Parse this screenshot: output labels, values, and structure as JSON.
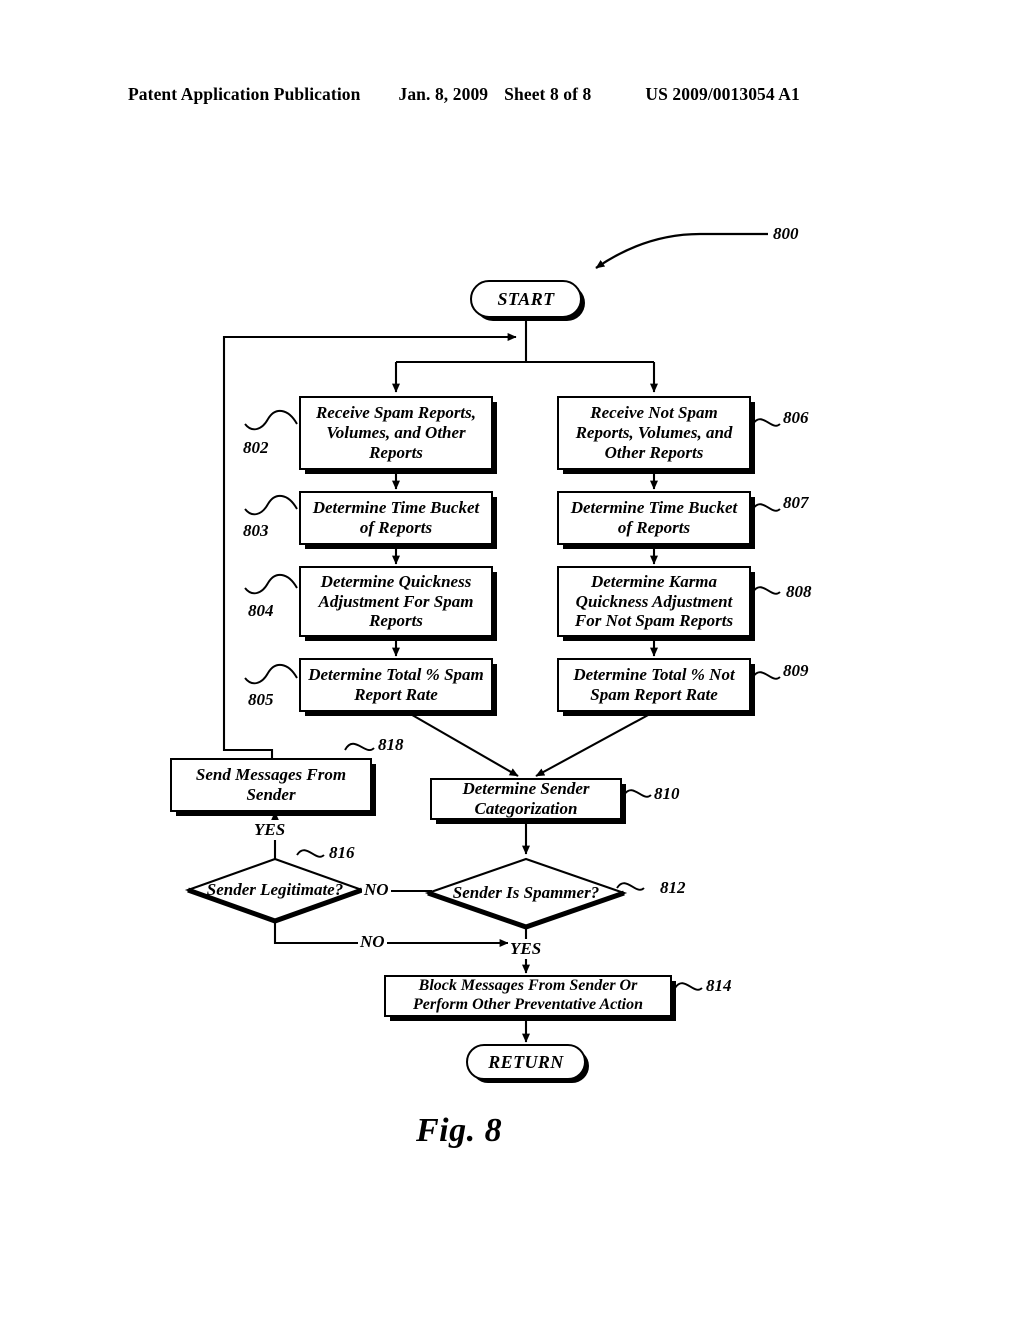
{
  "header": {
    "publication": "Patent Application Publication",
    "date": "Jan. 8, 2009",
    "sheet": "Sheet 8 of 8",
    "patent_number": "US 2009/0013054 A1"
  },
  "figure": {
    "caption": "Fig. 8",
    "diagram_ref": "800"
  },
  "terminators": {
    "start": "START",
    "return": "RETURN"
  },
  "nodes": {
    "n802": {
      "label": "Receive Spam Reports, Volumes, and Other Reports",
      "ref": "802"
    },
    "n803": {
      "label": "Determine Time Bucket of Reports",
      "ref": "803"
    },
    "n804": {
      "label": "Determine Quickness Adjustment For Spam Reports",
      "ref": "804"
    },
    "n805": {
      "label": "Determine Total % Spam Report Rate",
      "ref": "805"
    },
    "n806": {
      "label": "Receive Not Spam Reports, Volumes, and Other Reports",
      "ref": "806"
    },
    "n807": {
      "label": "Determine Time Bucket of Reports",
      "ref": "807"
    },
    "n808": {
      "label": "Determine Karma Quickness Adjustment For Not Spam Reports",
      "ref": "808"
    },
    "n809": {
      "label": "Determine Total % Not Spam Report Rate",
      "ref": "809"
    },
    "n810": {
      "label": "Determine Sender Categorization",
      "ref": "810"
    },
    "n814": {
      "label": "Block Messages From Sender Or Perform Other Preventative Action",
      "ref": "814"
    },
    "n818": {
      "label": "Send Messages From Sender",
      "ref": "818"
    }
  },
  "decisions": {
    "d812": {
      "label": "Sender Is Spammer?",
      "ref": "812"
    },
    "d816": {
      "label": "Sender Legitimate?",
      "ref": "816"
    }
  },
  "edge_labels": {
    "spammer_yes": "YES",
    "spammer_no": "NO",
    "legitimate_yes": "YES",
    "legitimate_no": "NO"
  },
  "colors": {
    "ink": "#000000",
    "paper": "#ffffff"
  }
}
